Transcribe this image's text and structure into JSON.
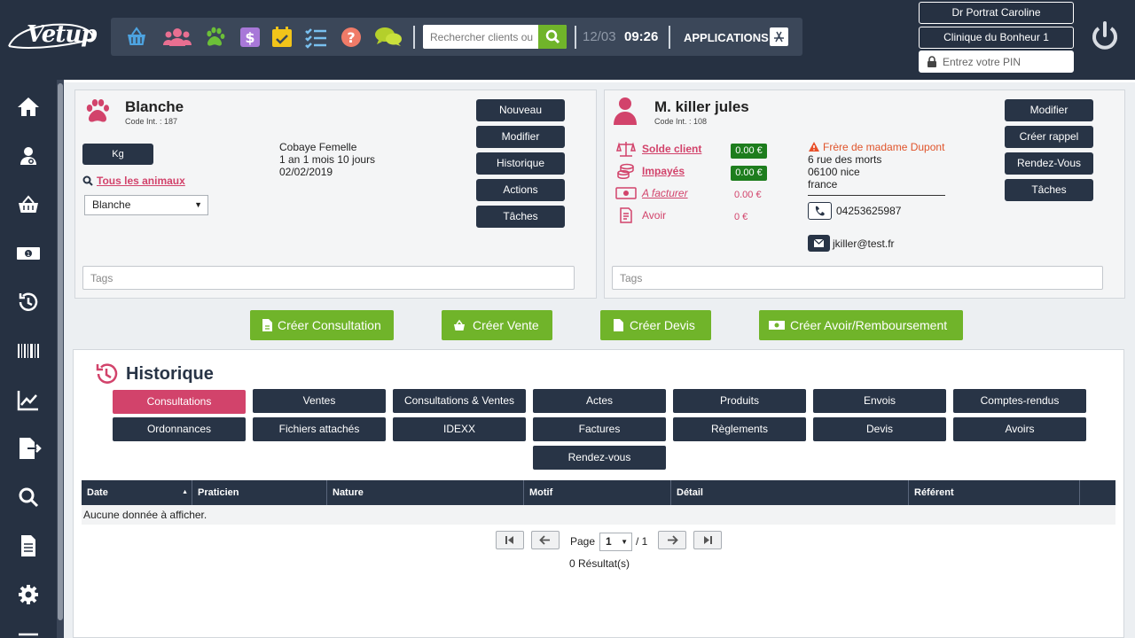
{
  "header": {
    "logo_text": "Vetup",
    "search_placeholder": "Rechercher clients ou",
    "date": "12/03",
    "time": "09:26",
    "applications_label": "APPLICATIONS",
    "practitioner": "Dr Portrat Caroline",
    "clinic": "Clinique du Bonheur 1",
    "pin_placeholder": "Entrez votre PIN",
    "toolbar_icons": [
      "basket-icon",
      "clients-icon",
      "paw-icon",
      "dollar-icon",
      "calendar-icon",
      "checklist-icon",
      "help-icon",
      "chat-icon"
    ]
  },
  "sidebar": {
    "items": [
      "home-icon",
      "client-icon",
      "shop-icon",
      "cash-icon",
      "history-icon",
      "barcode-icon",
      "stats-icon",
      "export-icon",
      "search-icon",
      "document-icon",
      "settings-icon"
    ]
  },
  "animal": {
    "name": "Blanche",
    "code": "Code Int. : 187",
    "kg_label": "Kg",
    "species": "Cobaye Femelle",
    "age": "1 an 1 mois 10 jours",
    "birthdate": "02/02/2019",
    "all_animals_label": "Tous les animaux",
    "selected_animal": "Blanche",
    "buttons": [
      "Nouveau",
      "Modifier",
      "Historique",
      "Actions",
      "Tâches"
    ],
    "tags_placeholder": "Tags"
  },
  "client": {
    "name": "M. killer jules",
    "code": "Code Int. : 108",
    "solde_label": "Solde client",
    "solde_value": "0.00 €",
    "impayes_label": "Impayés",
    "impayes_value": "0.00 €",
    "facturer_label": "A facturer",
    "facturer_value": "0.00 €",
    "avoir_label": "Avoir",
    "avoir_value": "0 €",
    "alert": "Frère de madame Dupont",
    "address_line1": "6 rue des morts",
    "address_line2": "06100 nice",
    "address_line3": "france",
    "phone": "04253625987",
    "email": "jkiller@test.fr",
    "buttons": [
      "Modifier",
      "Créer rappel",
      "Rendez-Vous",
      "Tâches"
    ],
    "tags_placeholder": "Tags"
  },
  "actions": {
    "consultation": "Créer Consultation",
    "vente": "Créer Vente",
    "devis": "Créer Devis",
    "avoir": "Créer Avoir/Remboursement"
  },
  "history": {
    "title": "Historique",
    "tabs_row1": [
      "Consultations",
      "Ventes",
      "Consultations & Ventes",
      "Actes",
      "Produits",
      "Envois",
      "Comptes-rendus"
    ],
    "tabs_row2": [
      "Ordonnances",
      "Fichiers attachés",
      "IDEXX",
      "Factures",
      "Règlements",
      "Devis",
      "Avoirs"
    ],
    "tab_row3": "Rendez-vous",
    "active_tab": "Consultations",
    "columns": [
      "Date",
      "Praticien",
      "Nature",
      "Motif",
      "Détail",
      "Référent"
    ],
    "empty_message": "Aucune donnée à afficher.",
    "page_label": "Page",
    "page_current": "1",
    "page_total": "/ 1",
    "results": "0 Résultat(s)"
  },
  "colors": {
    "navy": "#263142",
    "accent_pink": "#d2436b",
    "green": "#70b42a",
    "badge_green": "#1d7d1d"
  }
}
